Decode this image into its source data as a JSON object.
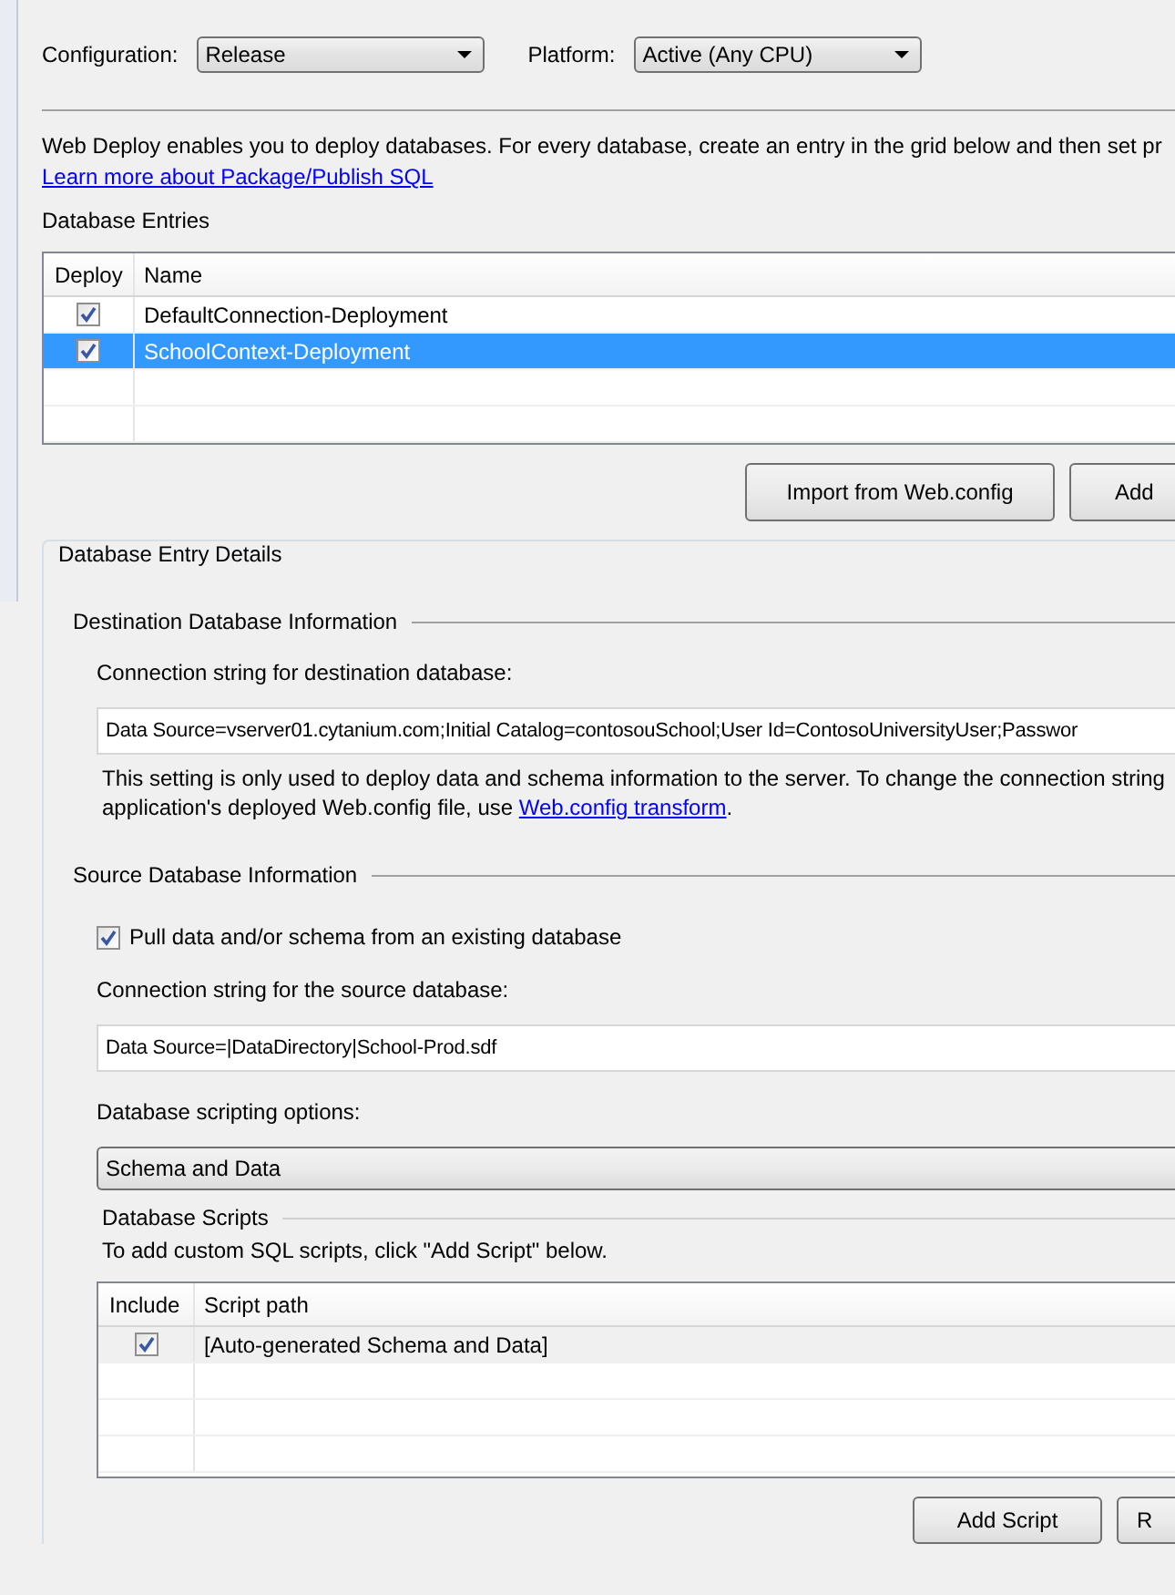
{
  "configuration": {
    "label": "Configuration:",
    "value": "Release"
  },
  "platform": {
    "label": "Platform:",
    "value": "Active (Any CPU)"
  },
  "description": "Web Deploy enables you to deploy databases. For every database, create an entry in the grid below and then set pr",
  "learn_more_link": "Learn more about Package/Publish SQL",
  "database_entries": {
    "title": "Database Entries",
    "focused": true,
    "columns": [
      "Deploy",
      "Name"
    ],
    "rows": [
      {
        "deploy": true,
        "name": "DefaultConnection-Deployment",
        "selected": false
      },
      {
        "deploy": true,
        "name": "SchoolContext-Deployment",
        "selected": true
      }
    ]
  },
  "entry_buttons": [
    "Import from Web.config",
    "Add"
  ],
  "details": {
    "title": "Database Entry Details",
    "destination": {
      "title": "Destination Database Information",
      "connection_label": "Connection string for destination database:",
      "connection_value": "Data Source=vserver01.cytanium.com;Initial Catalog=contosouSchool;User Id=ContosoUniversityUser;Passwor",
      "note_lines": [
        "This setting is only used to deploy data and schema information to the server. To change the connection string",
        "application's deployed Web.config file, use"
      ],
      "note_link": "Web.config transform",
      "note_end": "."
    },
    "source": {
      "title": "Source Database Information",
      "pull_label": "Pull data and/or schema from an existing database",
      "pull_checked": true,
      "connection_label": "Connection string for the source database:",
      "connection_value": "Data Source=|DataDirectory|School-Prod.sdf",
      "scripting_label": "Database scripting options:",
      "scripting_value": "Schema and Data"
    },
    "scripts": {
      "title": "Database Scripts",
      "hint": "To add custom SQL scripts, click \"Add Script\" below.",
      "focused": false,
      "columns": [
        "Include",
        "Script path"
      ],
      "rows": [
        {
          "include": true,
          "path": "[Auto-generated Schema and Data]",
          "selected": true
        }
      ]
    },
    "script_buttons": [
      "Add Script",
      "R"
    ]
  }
}
